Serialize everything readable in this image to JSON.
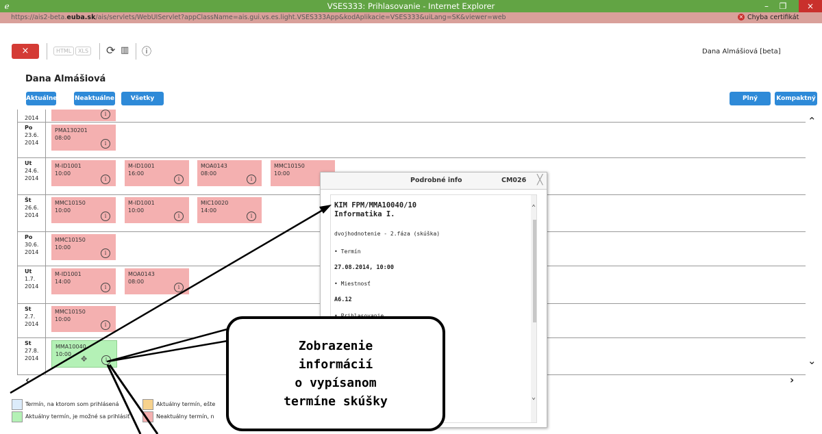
{
  "window": {
    "title": "VSES333: Prihlasovanie - Internet Explorer",
    "minimize": "–",
    "maximize": "❐",
    "close": "×"
  },
  "address": {
    "url_prefix": "https://ais2-beta.",
    "url_domain": "euba.sk",
    "url_suffix": "/ais/servlets/WebUIServlet?appClassName=ais.gui.vs.es.light.VSES333App&kodAplikacie=VSES333&uiLang=SK&viewer=web",
    "cert_error": "Chyba certifikát"
  },
  "toolbar": {
    "close": "×",
    "html": "HTML",
    "xls": "XLS",
    "user": "Dana Almášiová [beta]"
  },
  "page": {
    "title": "Dana Almášiová",
    "filters": [
      "Aktuálne",
      "Neaktuálne",
      "Všetky"
    ],
    "views": [
      "Plný",
      "Kompaktný"
    ]
  },
  "calendar": {
    "rows": [
      {
        "day": "",
        "date": "",
        "year": "2014",
        "events": [
          {
            "code": "",
            "time": "",
            "color": "red"
          }
        ]
      },
      {
        "day": "Po",
        "date": "23.6.",
        "year": "2014",
        "events": [
          {
            "code": "PMA130201",
            "time": "08:00",
            "color": "red"
          }
        ]
      },
      {
        "day": "Ut",
        "date": "24.6.",
        "year": "2014",
        "events": [
          {
            "code": "M-ID1001",
            "time": "10:00",
            "color": "red"
          },
          {
            "code": "M-ID1001",
            "time": "16:00",
            "color": "red"
          },
          {
            "code": "MOA0143",
            "time": "08:00",
            "color": "red"
          },
          {
            "code": "MMC10150",
            "time": "10:00",
            "color": "red"
          }
        ]
      },
      {
        "day": "Št",
        "date": "26.6.",
        "year": "2014",
        "events": [
          {
            "code": "MMC10150",
            "time": "10:00",
            "color": "red"
          },
          {
            "code": "M-ID1001",
            "time": "10:00",
            "color": "red"
          },
          {
            "code": "MIC10020",
            "time": "14:00",
            "color": "red"
          }
        ]
      },
      {
        "day": "Po",
        "date": "30.6.",
        "year": "2014",
        "events": [
          {
            "code": "MMC10150",
            "time": "10:00",
            "color": "red"
          }
        ]
      },
      {
        "day": "Ut",
        "date": "1.7.",
        "year": "2014",
        "events": [
          {
            "code": "M-ID1001",
            "time": "14:00",
            "color": "red"
          },
          {
            "code": "MOA0143",
            "time": "08:00",
            "color": "red"
          }
        ]
      },
      {
        "day": "St",
        "date": "2.7.",
        "year": "2014",
        "events": [
          {
            "code": "MMC10150",
            "time": "10:00",
            "color": "red"
          }
        ]
      },
      {
        "day": "St",
        "date": "27.8.",
        "year": "2014",
        "events": [
          {
            "code": "MMA10040",
            "time": "10:00",
            "color": "green"
          }
        ]
      }
    ]
  },
  "popup": {
    "title": "Podrobné info",
    "code": "CM026",
    "heading1": "KIM FPM/MMA10040/10",
    "heading2": "Informatika I.",
    "type": "dvojhodnotenie - 2.fáza (skúška)",
    "label_term": "•  Termín",
    "term": "27.08.2014, 10:00",
    "label_room": "•  Miestnosť",
    "room": "A6.12",
    "label_reg": "•  Prihlasovanie"
  },
  "callout": {
    "lines": [
      "Zobrazenie",
      "informácií",
      "o vypísanom",
      "termíne skúšky"
    ]
  },
  "legend": {
    "registered": "Termín, na ktorom som prihlásená",
    "current_can_register": "Aktuálny termín, je možné sa prihlásiť",
    "current_not_yet": "Aktuálny termín, ešte",
    "not_current": "Neaktuálny termín, n"
  },
  "colors": {
    "titlebar": "#62a444",
    "addressbar": "#d9a09a",
    "accent": "#2e8ad8",
    "event_red": "#f4b0b0",
    "event_green": "#b4f1b6",
    "legend_blue": "#dcecfb",
    "legend_orange": "#f7d28d"
  }
}
